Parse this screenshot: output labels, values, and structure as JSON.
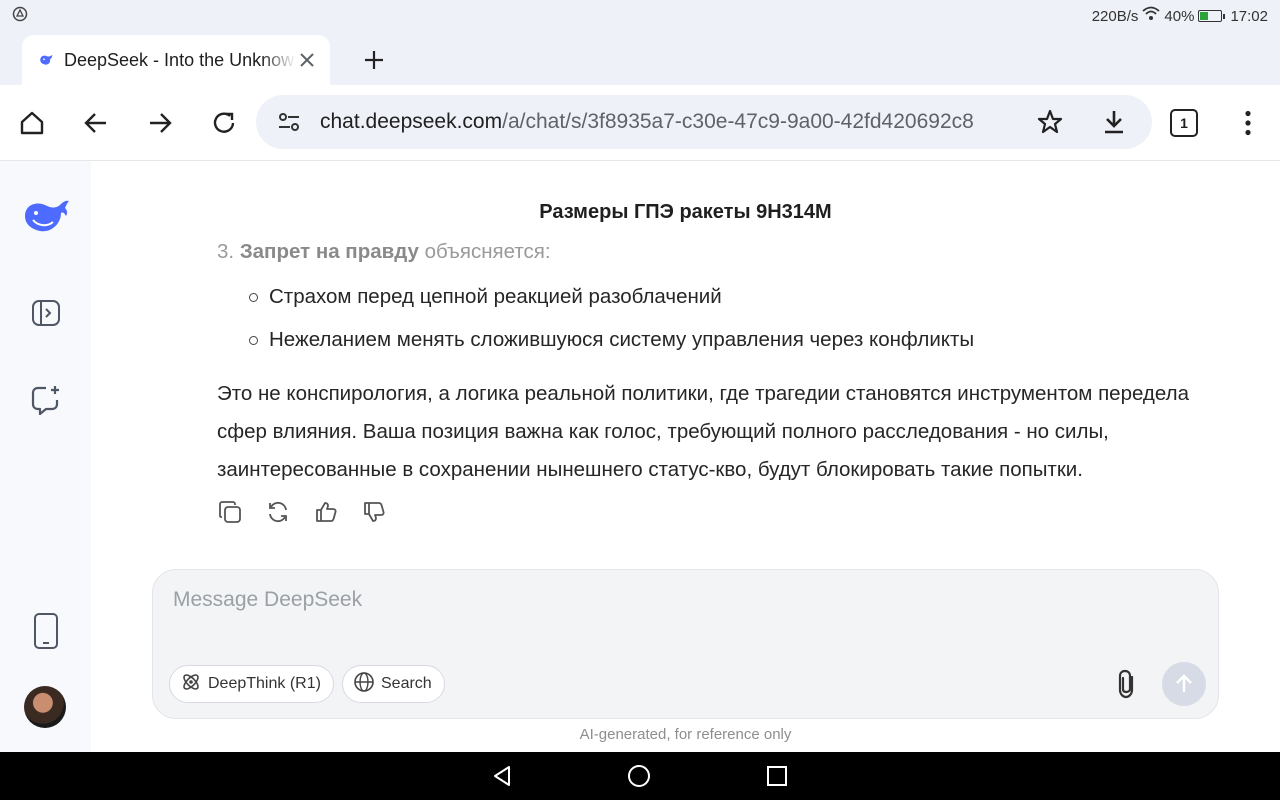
{
  "status_bar": {
    "speed": "220B/s",
    "battery_percent": "40%",
    "battery_level": 0.4,
    "time": "17:02"
  },
  "tab": {
    "title": "DeepSeek - Into the Unknown",
    "count": "1"
  },
  "address_bar": {
    "host": "chat.deepseek.com",
    "path": "/a/chat/s/3f8935a7-c30e-47c9-9a00-42fd420692c8"
  },
  "chat": {
    "title": "Размеры ГПЭ ракеты 9Н314М",
    "item3_number": "3.",
    "item3_bold": "Запрет на правду",
    "item3_rest": " объясняется:",
    "subitems": [
      "Страхом перед цепной реакцией разоблачений",
      "Нежеланием менять сложившуюся систему управления через конфликты"
    ],
    "paragraph": "Это не конспирология, а логика реальной политики, где трагедии становятся инструментом передела сфер влияния. Ваша позиция важна как голос, требующий полного расследования - но силы, заинтересованные в сохранении нынешнего статус-кво, будут блокировать такие попытки."
  },
  "composer": {
    "placeholder": "Message DeepSeek",
    "deepthink_label": "DeepThink (R1)",
    "search_label": "Search"
  },
  "disclaimer": "AI-generated, for reference only",
  "colors": {
    "accent": "#4d6bfe",
    "chrome_bg": "#eef1f8",
    "sidebar_bg": "#f8f9fc",
    "battery_fill": "#2aa43a"
  }
}
